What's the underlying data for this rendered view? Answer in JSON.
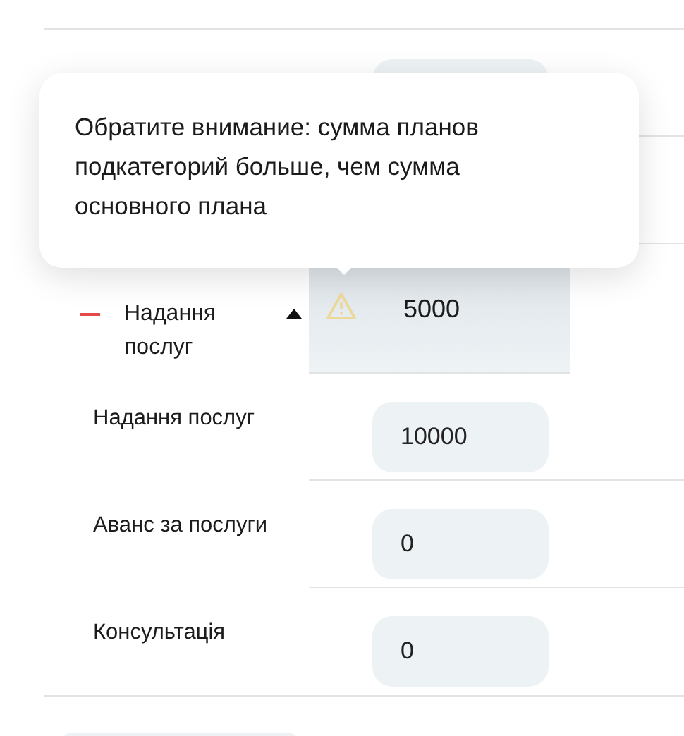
{
  "rows": [
    {
      "kind": "input"
    },
    {
      "kind": "hidden"
    },
    {
      "name": "Надання послуг",
      "kind": "group",
      "expanded": true,
      "warning": true,
      "value": "5000",
      "children": [
        {
          "name": "Надання послуг",
          "value": "10000"
        },
        {
          "name": "Аванс за послуги",
          "value": "0"
        },
        {
          "name": "Консультація",
          "value": "0"
        }
      ]
    }
  ],
  "tooltip": {
    "text": "Обратите внимание: сумма планов подкатегорий больше, чем сумма основного плана"
  },
  "bottom_button": {
    "kind": "pill"
  }
}
